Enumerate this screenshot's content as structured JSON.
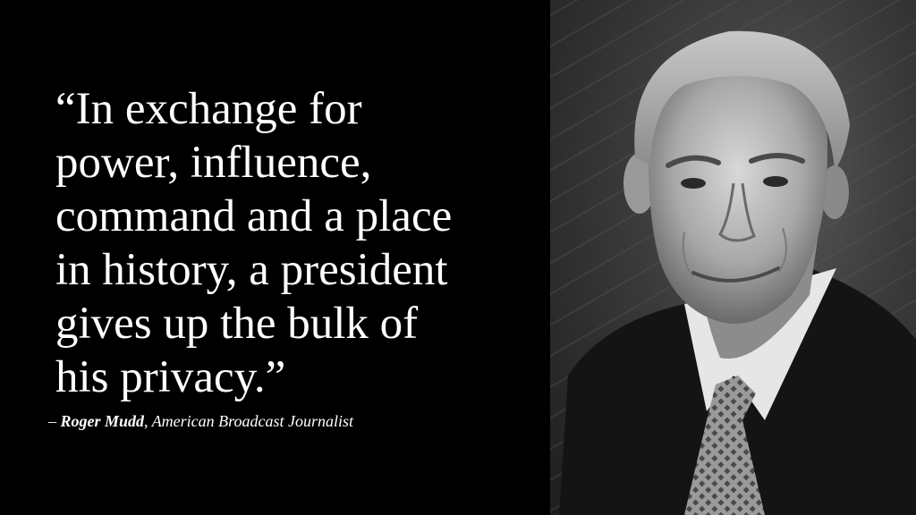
{
  "quote": {
    "lines": [
      "“In exchange for",
      "power, influence,",
      "command and a place",
      "in history, a president",
      "gives up the bulk of",
      "his privacy.”"
    ]
  },
  "attribution": {
    "dash": "– ",
    "name": "Roger Mudd",
    "title": ", American Broadcast Journalist"
  },
  "colors": {
    "background": "#000000",
    "text": "#ffffff"
  }
}
